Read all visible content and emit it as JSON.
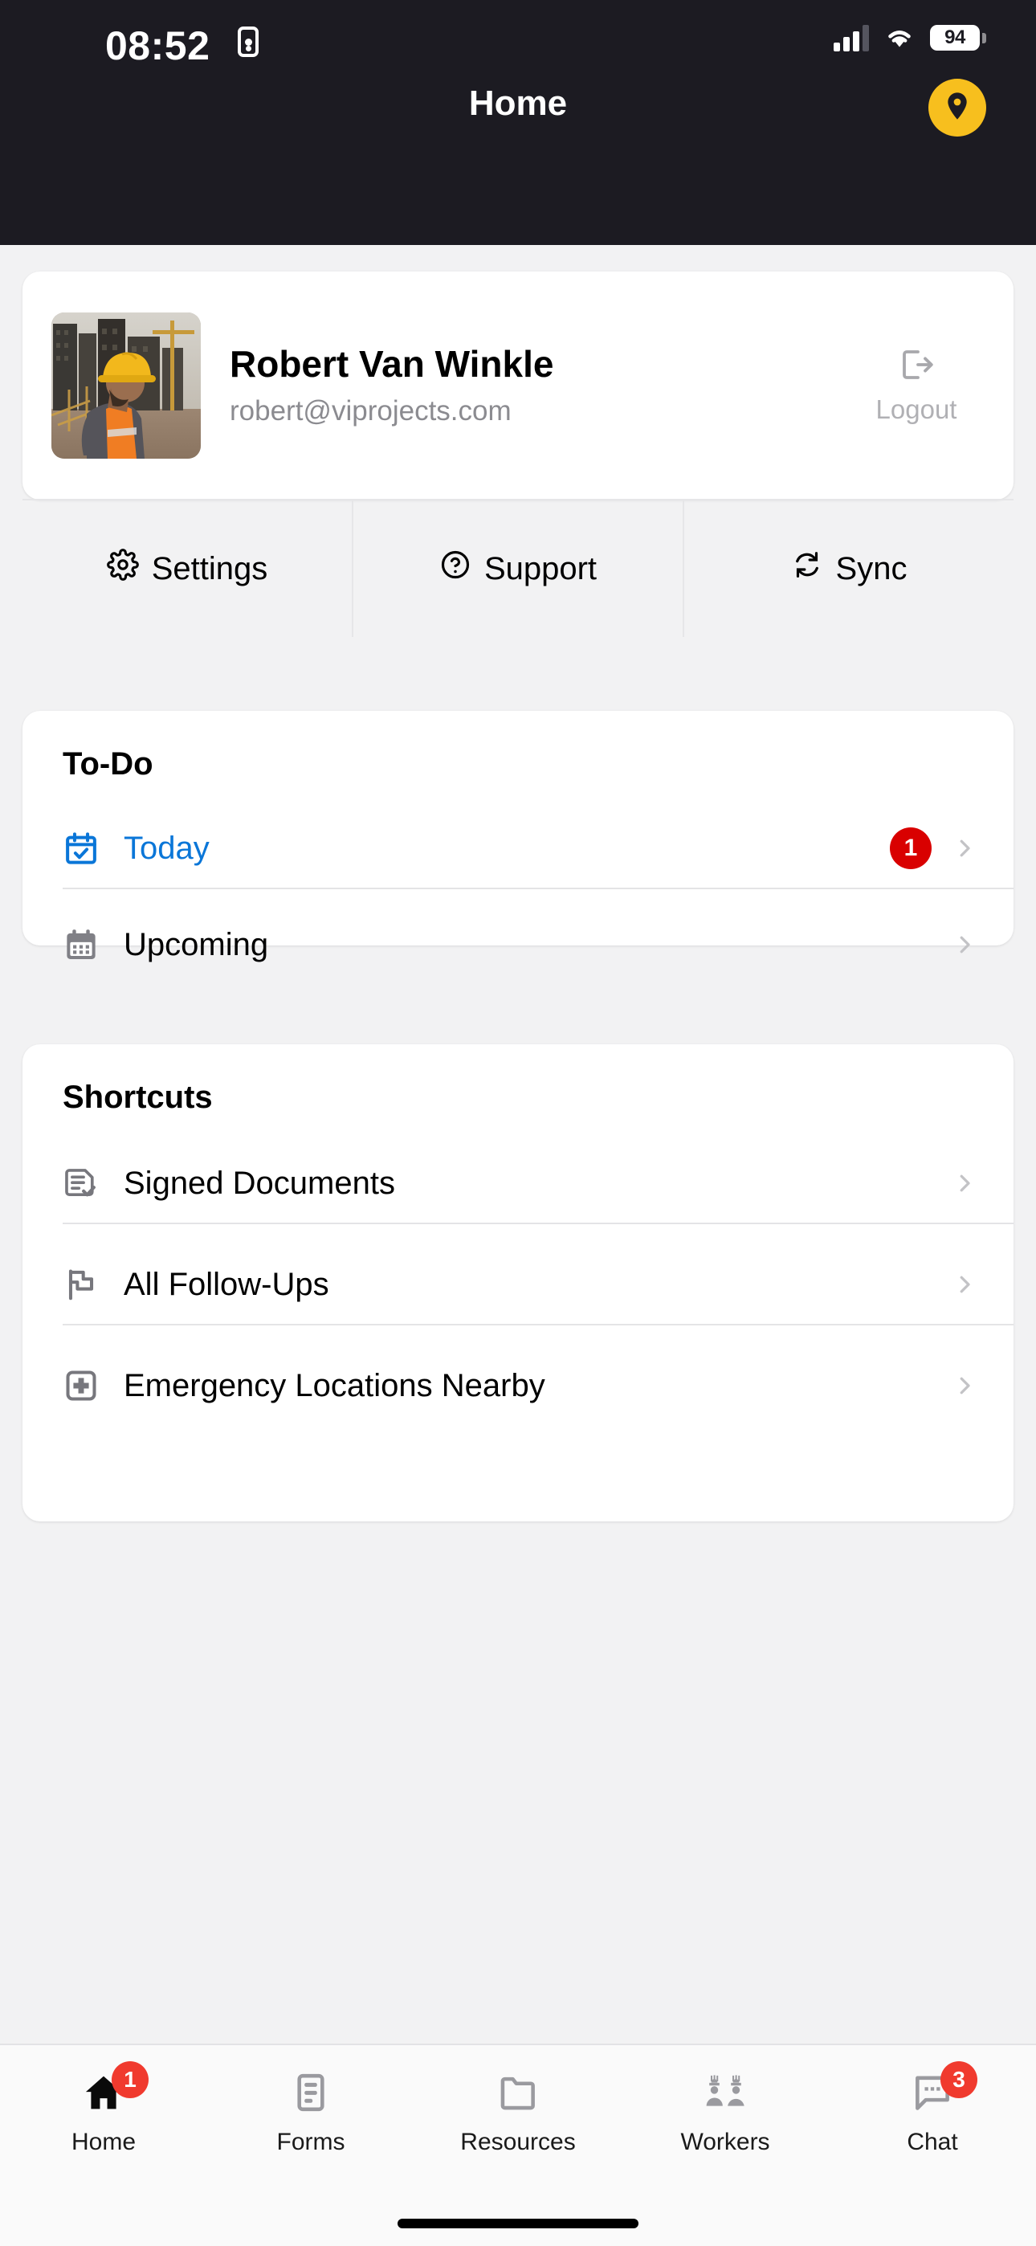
{
  "status_bar": {
    "time": "08:52",
    "lock_icon": "privacy-lock-icon",
    "cellular_icon": "cellular-signal-icon",
    "wifi_icon": "wifi-icon",
    "battery_percent": "94"
  },
  "header": {
    "title": "Home",
    "location_button_icon": "location-pin-icon",
    "accent_color": "#f7bf1e",
    "background_color": "#1c1b22"
  },
  "profile": {
    "name": "Robert Van Winkle",
    "email": "robert@viprojects.com",
    "avatar_icon": "construction-worker-avatar",
    "logout_label": "Logout",
    "logout_icon": "logout-icon",
    "actions": [
      {
        "label": "Settings",
        "icon": "gear-icon"
      },
      {
        "label": "Support",
        "icon": "question-circle-icon"
      },
      {
        "label": "Sync",
        "icon": "sync-refresh-icon"
      }
    ]
  },
  "todo": {
    "title": "To-Do",
    "items": [
      {
        "label": "Today",
        "icon": "calendar-check-icon",
        "badge": "1",
        "accent": true,
        "accent_color": "#0a76d8"
      },
      {
        "label": "Upcoming",
        "icon": "calendar-days-icon",
        "badge": "",
        "accent": false
      }
    ]
  },
  "shortcuts": {
    "title": "Shortcuts",
    "items": [
      {
        "label": "Signed Documents",
        "icon": "document-check-icon"
      },
      {
        "label": "All Follow-Ups",
        "icon": "flag-icon"
      },
      {
        "label": "Emergency Locations Nearby",
        "icon": "medical-cross-icon"
      }
    ]
  },
  "tabbar": {
    "badge_color": "#f03a2e",
    "tabs": [
      {
        "label": "Home",
        "icon": "home-icon",
        "badge": "1",
        "active": true
      },
      {
        "label": "Forms",
        "icon": "forms-document-icon",
        "badge": "",
        "active": false
      },
      {
        "label": "Resources",
        "icon": "folder-icon",
        "badge": "",
        "active": false
      },
      {
        "label": "Workers",
        "icon": "workers-hardhat-icon",
        "badge": "",
        "active": false
      },
      {
        "label": "Chat",
        "icon": "chat-bubble-icon",
        "badge": "3",
        "active": false
      }
    ]
  }
}
